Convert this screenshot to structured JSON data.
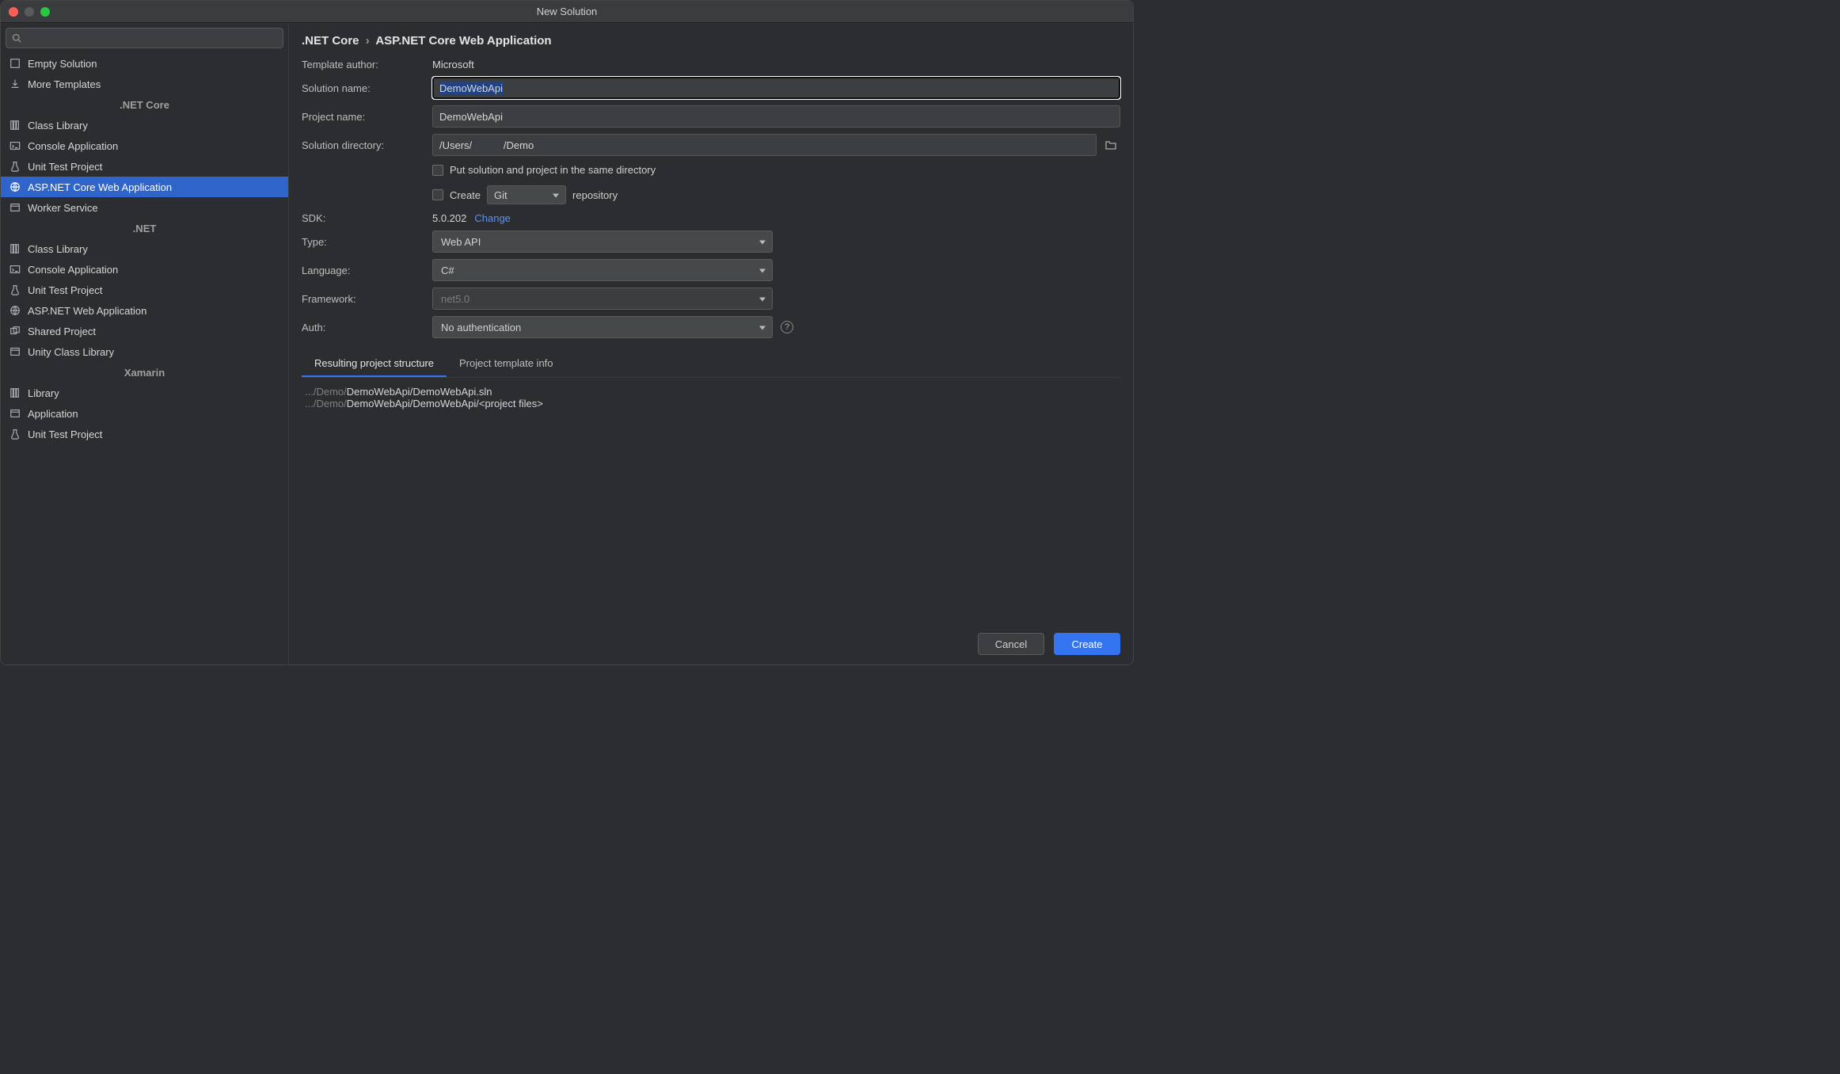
{
  "window": {
    "title": "New Solution"
  },
  "search": {
    "placeholder": ""
  },
  "sidebar": {
    "top": [
      {
        "icon": "empty-icon",
        "label": "Empty Solution"
      },
      {
        "icon": "download-icon",
        "label": "More Templates"
      }
    ],
    "groups": [
      {
        "name": ".NET Core",
        "items": [
          {
            "icon": "library-icon",
            "label": "Class Library"
          },
          {
            "icon": "console-icon",
            "label": "Console Application"
          },
          {
            "icon": "test-icon",
            "label": "Unit Test Project"
          },
          {
            "icon": "globe-icon",
            "label": "ASP.NET Core Web Application",
            "selected": true
          },
          {
            "icon": "window-icon",
            "label": "Worker Service"
          }
        ]
      },
      {
        "name": ".NET",
        "items": [
          {
            "icon": "library-icon",
            "label": "Class Library"
          },
          {
            "icon": "console-icon",
            "label": "Console Application"
          },
          {
            "icon": "test-icon",
            "label": "Unit Test Project"
          },
          {
            "icon": "globe-icon",
            "label": "ASP.NET Web Application"
          },
          {
            "icon": "shared-icon",
            "label": "Shared Project"
          },
          {
            "icon": "window-icon",
            "label": "Unity Class Library"
          }
        ]
      },
      {
        "name": "Xamarin",
        "items": [
          {
            "icon": "library-icon",
            "label": "Library"
          },
          {
            "icon": "window-icon",
            "label": "Application"
          },
          {
            "icon": "test-icon",
            "label": "Unit Test Project"
          }
        ]
      }
    ]
  },
  "breadcrumb": {
    "root": ".NET Core",
    "leaf": "ASP.NET Core Web Application"
  },
  "form": {
    "template_author_label": "Template author:",
    "template_author_value": "Microsoft",
    "solution_name_label": "Solution name:",
    "solution_name_value": "DemoWebApi",
    "project_name_label": "Project name:",
    "project_name_value": "DemoWebApi",
    "solution_dir_label": "Solution directory:",
    "solution_dir_value": "/Users/           /Demo",
    "same_dir_label": "Put solution and project in the same directory",
    "create_label": "Create",
    "git_select": "Git",
    "repository_suffix": "repository",
    "sdk_label": "SDK:",
    "sdk_value": "5.0.202",
    "sdk_change": "Change",
    "type_label": "Type:",
    "type_value": "Web API",
    "language_label": "Language:",
    "language_value": "C#",
    "framework_label": "Framework:",
    "framework_value": "net5.0",
    "auth_label": "Auth:",
    "auth_value": "No authentication"
  },
  "tabs": {
    "structure": "Resulting project structure",
    "info": "Project template info"
  },
  "result": {
    "line1_dim": ".../Demo/",
    "line1_rest": "DemoWebApi/DemoWebApi.sln",
    "line2_dim": ".../Demo/",
    "line2_rest": "DemoWebApi/DemoWebApi/<project files>"
  },
  "footer": {
    "cancel": "Cancel",
    "create": "Create"
  }
}
